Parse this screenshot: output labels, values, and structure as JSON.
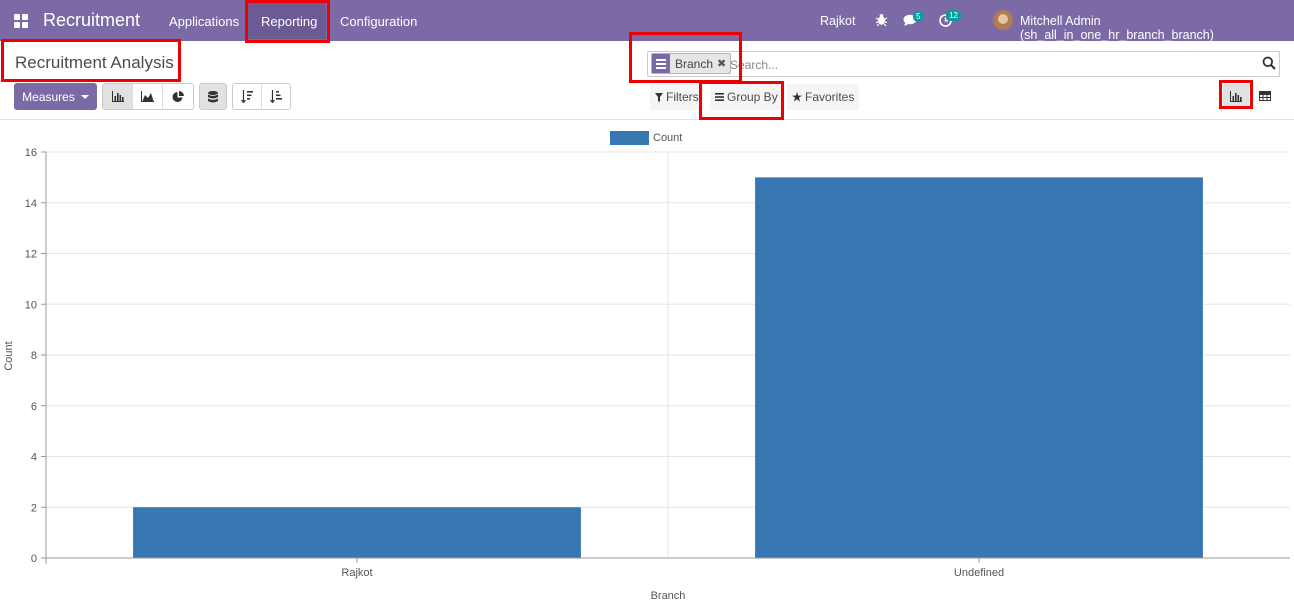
{
  "navbar": {
    "brand": "Recruitment",
    "menu": [
      "Applications",
      "Reporting",
      "Configuration"
    ],
    "company": "Rajkot",
    "messages_badge": "5",
    "activities_badge": "12",
    "user": "Mitchell Admin (sh_all_in_one_hr_branch_branch)",
    "bar_color": "#7c6aa6"
  },
  "control_panel": {
    "title": "Recruitment Analysis",
    "facet_label": "Branch",
    "search_placeholder": "Search...",
    "measures_label": "Measures",
    "filters_label": "Filters",
    "groupby_label": "Group By",
    "favorites_label": "Favorites"
  },
  "chart_data": {
    "type": "bar",
    "categories": [
      "Rajkot",
      "Undefined"
    ],
    "series": [
      {
        "name": "Count",
        "values": [
          2,
          15
        ],
        "color": "#3777b2"
      }
    ],
    "xlabel": "Branch",
    "ylabel": "Count",
    "ylim": [
      0,
      16
    ],
    "yticks": [
      0,
      2,
      4,
      6,
      8,
      10,
      12,
      14,
      16
    ],
    "grid": true,
    "legend": "top-center"
  }
}
